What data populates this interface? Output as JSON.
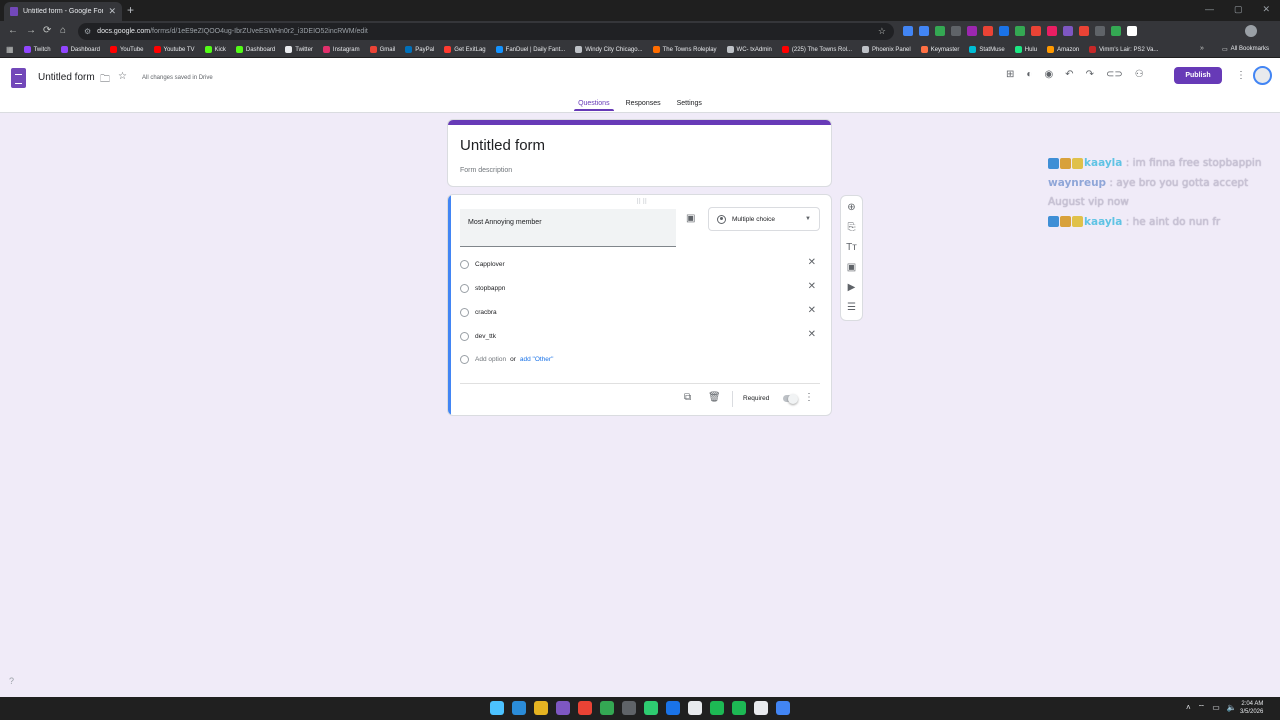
{
  "browser": {
    "tab_title": "Untitled form - Google Forms",
    "url_host": "docs.google.com",
    "url_path": "/forms/d/1eE9eZIQOO4ug-IbrZUveESWHn0r2_i3DEIO52incRWM/edit",
    "new_tab": "+",
    "bookmarks": [
      {
        "label": "Twitch",
        "color": "#9146ff"
      },
      {
        "label": "Dashboard",
        "color": "#9146ff"
      },
      {
        "label": "YouTube",
        "color": "#ff0000"
      },
      {
        "label": "Youtube TV",
        "color": "#ff0000"
      },
      {
        "label": "Kick",
        "color": "#53fc18"
      },
      {
        "label": "Dashboard",
        "color": "#53fc18"
      },
      {
        "label": "Twitter",
        "color": "#e8eaed"
      },
      {
        "label": "Instagram",
        "color": "#e1306c"
      },
      {
        "label": "Gmail",
        "color": "#ea4335"
      },
      {
        "label": "PayPal",
        "color": "#0070ba"
      },
      {
        "label": "Get ExitLag",
        "color": "#ff3b30"
      },
      {
        "label": "FanDuel | Daily Fant...",
        "color": "#1493ff"
      },
      {
        "label": "Windy City Chicago...",
        "color": "#bdc1c6"
      },
      {
        "label": "The Towns Roleplay",
        "color": "#ff6d00"
      },
      {
        "label": "WC- txAdmin",
        "color": "#bdc1c6"
      },
      {
        "label": "(225) The Towns Rol...",
        "color": "#ff0000"
      },
      {
        "label": "Phoenix Panel",
        "color": "#bdc1c6"
      },
      {
        "label": "Keymaster",
        "color": "#ff7043"
      },
      {
        "label": "StatMuse",
        "color": "#00bcd4"
      },
      {
        "label": "Hulu",
        "color": "#1ce783"
      },
      {
        "label": "Amazon",
        "color": "#ff9900"
      },
      {
        "label": "Vimm's Lair: PS2 Va...",
        "color": "#c62828"
      }
    ],
    "all_bookmarks": "All Bookmarks",
    "extension_colors": [
      "#4285f4",
      "#4285f4",
      "#34a853",
      "#5f6368",
      "#9c27b0",
      "#ea4335",
      "#1a73e8",
      "#34a853",
      "#ea4335",
      "#e91e63",
      "#7e57c2",
      "#ea4335",
      "#5f6368",
      "#34a853",
      "#ffffff"
    ]
  },
  "forms": {
    "doc_title": "Untitled form",
    "save_status": "All changes saved in Drive",
    "publish_label": "Publish",
    "tabs": [
      "Questions",
      "Responses",
      "Settings"
    ],
    "active_tab": "Questions",
    "accent_color": "#673ab7"
  },
  "form": {
    "title": "Untitled form",
    "description_placeholder": "Form description"
  },
  "question": {
    "text": "Most Annoying member",
    "type": "Multiple choice",
    "options": [
      "Capplover",
      "stopbappn",
      "cracbra",
      "dev_ttk"
    ],
    "add_option": "Add option",
    "or_text": "or",
    "add_other": "add \"Other\"",
    "required_label": "Required",
    "required": false
  },
  "chat": [
    {
      "user": "kaayla",
      "user_color": "#5fc3e4",
      "message": ": im finna free stopbappin",
      "emotes": [
        "#3f8fd6",
        "#d8a13b",
        "#e0c14a"
      ]
    },
    {
      "user": "waynreup",
      "user_color": "#8fa6d8",
      "message": ": aye bro you gotta accept",
      "emotes": []
    },
    {
      "user": "",
      "user_color": "#c9c3d6",
      "message": "August vip now",
      "emotes": []
    },
    {
      "user": "kaayla",
      "user_color": "#5fc3e4",
      "message": ": he aint do nun fr",
      "emotes": [
        "#3f8fd6",
        "#d8a13b",
        "#e0c14a"
      ]
    }
  ],
  "taskbar": {
    "app_colors": [
      "#2b8cd8",
      "#e6b422",
      "#7e57c2",
      "#ea4335",
      "#34a853",
      "#5f6368",
      "#2ecc71",
      "#1a73e8",
      "#e8eaed",
      "#1db954",
      "#1db954",
      "#e8eaed",
      "#4285f4"
    ],
    "time": "2:04 AM",
    "date": "3/5/2026"
  }
}
